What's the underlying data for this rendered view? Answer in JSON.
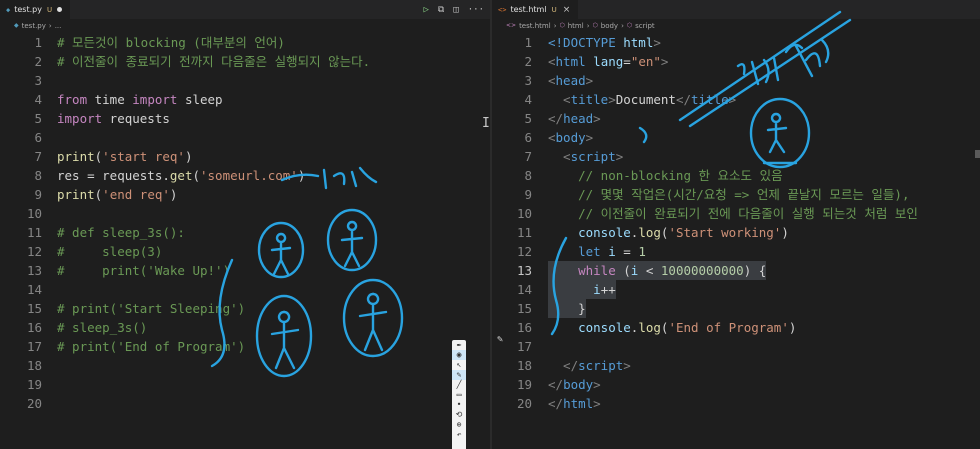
{
  "left": {
    "tab": {
      "icon": "python-file-icon",
      "name": "test.py",
      "status": "U"
    },
    "breadcrumb": "test.py",
    "lines": [
      {
        "n": "1",
        "tokens": [
          {
            "t": "# 모든것이 blocking (대부분의 언어)",
            "c": "c"
          }
        ]
      },
      {
        "n": "2",
        "tokens": [
          {
            "t": "# 이전줄이 종료되기 전까지 다음줄은 실행되지 않는다.",
            "c": "c"
          }
        ]
      },
      {
        "n": "3",
        "tokens": []
      },
      {
        "n": "4",
        "tokens": [
          {
            "t": "from",
            "c": "k"
          },
          {
            "t": " time ",
            "c": "id"
          },
          {
            "t": "import",
            "c": "k"
          },
          {
            "t": " sleep",
            "c": "id"
          }
        ]
      },
      {
        "n": "5",
        "tokens": [
          {
            "t": "import",
            "c": "k"
          },
          {
            "t": " requests",
            "c": "id"
          }
        ]
      },
      {
        "n": "6",
        "tokens": []
      },
      {
        "n": "7",
        "tokens": [
          {
            "t": "print",
            "c": "fn"
          },
          {
            "t": "(",
            "c": "id"
          },
          {
            "t": "'start req'",
            "c": "s"
          },
          {
            "t": ")",
            "c": "id"
          }
        ]
      },
      {
        "n": "8",
        "tokens": [
          {
            "t": "res = requests.",
            "c": "id"
          },
          {
            "t": "get",
            "c": "fn"
          },
          {
            "t": "(",
            "c": "id"
          },
          {
            "t": "'someurl.com'",
            "c": "s"
          },
          {
            "t": ")",
            "c": "id"
          }
        ]
      },
      {
        "n": "9",
        "tokens": [
          {
            "t": "print",
            "c": "fn"
          },
          {
            "t": "(",
            "c": "id"
          },
          {
            "t": "'end req'",
            "c": "s"
          },
          {
            "t": ")",
            "c": "id"
          }
        ]
      },
      {
        "n": "10",
        "tokens": []
      },
      {
        "n": "11",
        "tokens": [
          {
            "t": "# def sleep_3s():",
            "c": "c"
          }
        ]
      },
      {
        "n": "12",
        "tokens": [
          {
            "t": "#     sleep(3)",
            "c": "c"
          }
        ]
      },
      {
        "n": "13",
        "tokens": [
          {
            "t": "#     print('Wake Up!')",
            "c": "c"
          }
        ]
      },
      {
        "n": "14",
        "tokens": []
      },
      {
        "n": "15",
        "tokens": [
          {
            "t": "# print('Start Sleeping')",
            "c": "c"
          }
        ]
      },
      {
        "n": "16",
        "tokens": [
          {
            "t": "# sleep_3s()",
            "c": "c"
          }
        ]
      },
      {
        "n": "17",
        "tokens": [
          {
            "t": "# print('End of Program')",
            "c": "c"
          }
        ]
      },
      {
        "n": "18",
        "tokens": []
      },
      {
        "n": "19",
        "tokens": []
      },
      {
        "n": "20",
        "tokens": []
      }
    ]
  },
  "right": {
    "tab": {
      "icon": "html-file-icon",
      "name": "test.html",
      "status": "U"
    },
    "breadcrumbs": [
      "test.html",
      "html",
      "body",
      "script"
    ],
    "current_line": "13",
    "lines": [
      {
        "n": "1",
        "tokens": [
          {
            "t": "<!DOCTYPE",
            "c": "b"
          },
          {
            "t": " html",
            "c": "at"
          },
          {
            "t": ">",
            "c": "t"
          }
        ]
      },
      {
        "n": "2",
        "tokens": [
          {
            "t": "<",
            "c": "t"
          },
          {
            "t": "html",
            "c": "b"
          },
          {
            "t": " lang",
            "c": "at"
          },
          {
            "t": "=",
            "c": "id"
          },
          {
            "t": "\"en\"",
            "c": "s"
          },
          {
            "t": ">",
            "c": "t"
          }
        ]
      },
      {
        "n": "3",
        "tokens": [
          {
            "t": "<",
            "c": "t"
          },
          {
            "t": "head",
            "c": "b"
          },
          {
            "t": ">",
            "c": "t"
          }
        ]
      },
      {
        "n": "4",
        "tokens": [
          {
            "t": "  <",
            "c": "t"
          },
          {
            "t": "title",
            "c": "b"
          },
          {
            "t": ">",
            "c": "t"
          },
          {
            "t": "Document",
            "c": "id"
          },
          {
            "t": "</",
            "c": "t"
          },
          {
            "t": "title",
            "c": "b"
          },
          {
            "t": ">",
            "c": "t"
          }
        ]
      },
      {
        "n": "5",
        "tokens": [
          {
            "t": "</",
            "c": "t"
          },
          {
            "t": "head",
            "c": "b"
          },
          {
            "t": ">",
            "c": "t"
          }
        ]
      },
      {
        "n": "6",
        "tokens": [
          {
            "t": "<",
            "c": "t"
          },
          {
            "t": "body",
            "c": "b"
          },
          {
            "t": ">",
            "c": "t"
          }
        ]
      },
      {
        "n": "7",
        "tokens": [
          {
            "t": "  <",
            "c": "t"
          },
          {
            "t": "script",
            "c": "b"
          },
          {
            "t": ">",
            "c": "t"
          }
        ]
      },
      {
        "n": "8",
        "tokens": [
          {
            "t": "    // non-blocking 한 요소도 있음",
            "c": "c"
          }
        ]
      },
      {
        "n": "9",
        "tokens": [
          {
            "t": "    // 몇몇 작업은(시간/요청 => 언제 끝날지 모르는 일들),",
            "c": "c"
          }
        ]
      },
      {
        "n": "10",
        "tokens": [
          {
            "t": "    // 이전줄이 완료되기 전에 다음줄이 실행 되는것 처럼 보인",
            "c": "c"
          }
        ]
      },
      {
        "n": "11",
        "tokens": [
          {
            "t": "    console",
            "c": "v"
          },
          {
            "t": ".",
            "c": "id"
          },
          {
            "t": "log",
            "c": "fn"
          },
          {
            "t": "(",
            "c": "id"
          },
          {
            "t": "'Start working'",
            "c": "s"
          },
          {
            "t": ")",
            "c": "id"
          }
        ]
      },
      {
        "n": "12",
        "tokens": [
          {
            "t": "    let",
            "c": "b"
          },
          {
            "t": " i",
            "c": "v"
          },
          {
            "t": " = ",
            "c": "id"
          },
          {
            "t": "1",
            "c": "n"
          }
        ]
      },
      {
        "n": "13",
        "tokens": [
          {
            "t": "    while",
            "c": "k"
          },
          {
            "t": " (",
            "c": "id"
          },
          {
            "t": "i",
            "c": "v"
          },
          {
            "t": " < ",
            "c": "id"
          },
          {
            "t": "10000000000",
            "c": "n"
          },
          {
            "t": ") {",
            "c": "id"
          }
        ]
      },
      {
        "n": "14",
        "tokens": [
          {
            "t": "      i",
            "c": "v"
          },
          {
            "t": "++",
            "c": "id"
          }
        ]
      },
      {
        "n": "15",
        "tokens": [
          {
            "t": "    }",
            "c": "id"
          }
        ]
      },
      {
        "n": "16",
        "tokens": [
          {
            "t": "    console",
            "c": "v"
          },
          {
            "t": ".",
            "c": "id"
          },
          {
            "t": "log",
            "c": "fn"
          },
          {
            "t": "(",
            "c": "id"
          },
          {
            "t": "'End of Program'",
            "c": "s"
          },
          {
            "t": ")",
            "c": "id"
          }
        ]
      },
      {
        "n": "17",
        "tokens": []
      },
      {
        "n": "18",
        "tokens": [
          {
            "t": "  </",
            "c": "t"
          },
          {
            "t": "script",
            "c": "b"
          },
          {
            "t": ">",
            "c": "t"
          }
        ]
      },
      {
        "n": "19",
        "tokens": [
          {
            "t": "</",
            "c": "t"
          },
          {
            "t": "body",
            "c": "b"
          },
          {
            "t": ">",
            "c": "t"
          }
        ]
      },
      {
        "n": "20",
        "tokens": [
          {
            "t": "</",
            "c": "t"
          },
          {
            "t": "html",
            "c": "b"
          },
          {
            "t": ">",
            "c": "t"
          }
        ]
      }
    ]
  },
  "editor_actions": [
    "run-icon",
    "compare-icon",
    "split-editor-icon",
    "more-icon"
  ],
  "annotations": {
    "ink_color": "#29a3e0",
    "drawing_toolbar_tools": [
      "pen-icon",
      "eye-icon",
      "select-icon",
      "highlighter-icon",
      "eraser-icon",
      "dot-icon",
      "shape-icon"
    ]
  }
}
